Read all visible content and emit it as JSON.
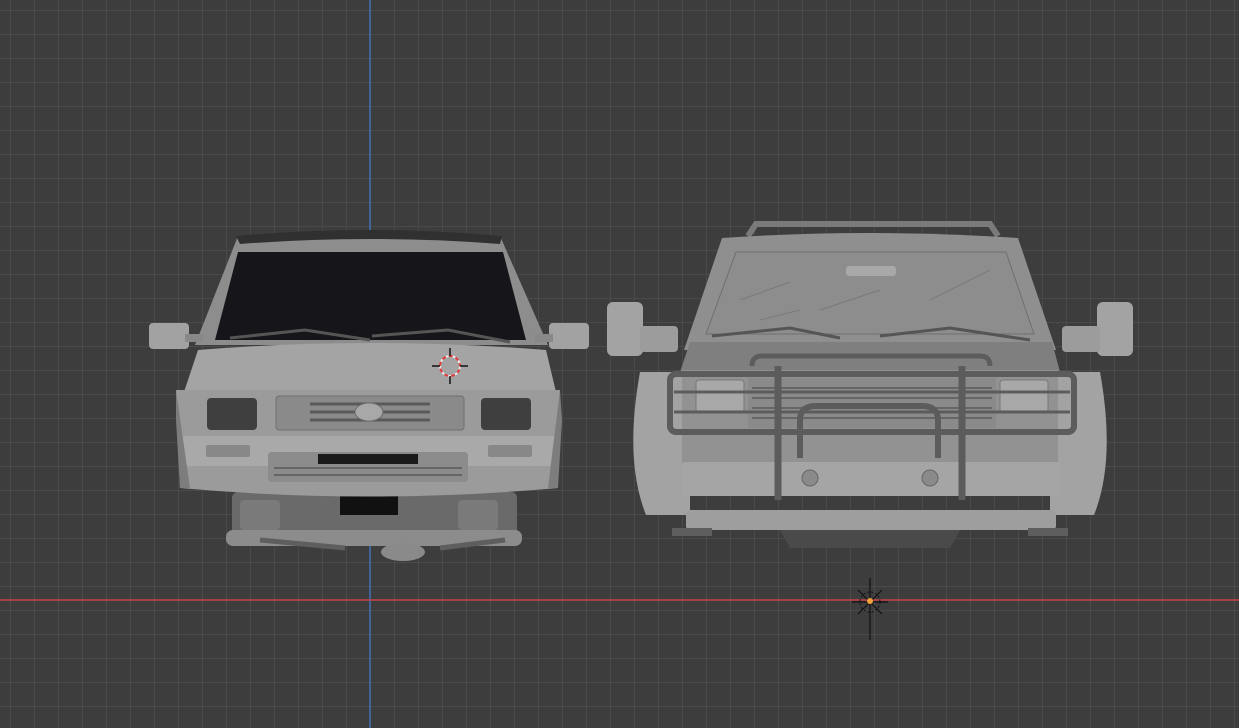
{
  "viewport": {
    "colors": {
      "background": "#3d3d3d",
      "grid": "#4a4a4a",
      "x_axis": "#c8424a",
      "z_axis": "#3f6fb5",
      "model_body": "#9a9a9a",
      "model_shadow": "#6e6e6e",
      "glass_dark": "#16161a",
      "glass_light": "#8c8c8c",
      "origin_dot": "#f2a33a",
      "cursor_red": "#e03c3c"
    },
    "objects": [
      {
        "name": "pickup-truck-front-view",
        "icon": "vehicle-model"
      },
      {
        "name": "suv-truck-front-view-with-bullbar",
        "icon": "vehicle-model"
      }
    ],
    "gizmos": [
      "3d-cursor-icon",
      "light-source-icon"
    ]
  }
}
